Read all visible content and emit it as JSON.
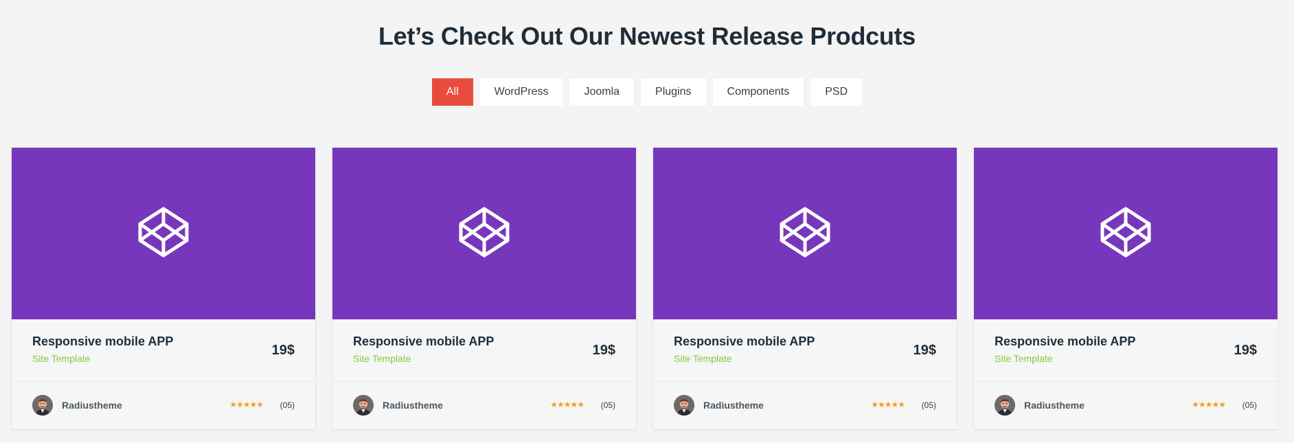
{
  "section": {
    "heading": "Let’s Check Out Our Newest Release Prodcuts"
  },
  "filters": {
    "items": [
      "All",
      "WordPress",
      "Joomla",
      "Plugins",
      "Components",
      "PSD"
    ],
    "active_index": 0
  },
  "colors": {
    "accent": "#e84c3d",
    "thumb_bg": "#7637bc",
    "subtitle_green": "#8cc63f",
    "star": "#f0a020"
  },
  "products": [
    {
      "title": "Responsive mobile APP",
      "category": "Site Template",
      "price": "19$",
      "author": "Radiustheme",
      "stars": "★★★★★",
      "rating_value": 5,
      "reviews": "(05)",
      "thumb_icon": "codepen-icon"
    },
    {
      "title": "Responsive mobile APP",
      "category": "Site Template",
      "price": "19$",
      "author": "Radiustheme",
      "stars": "★★★★★",
      "rating_value": 5,
      "reviews": "(05)",
      "thumb_icon": "codepen-icon"
    },
    {
      "title": "Responsive mobile APP",
      "category": "Site Template",
      "price": "19$",
      "author": "Radiustheme",
      "stars": "★★★★★",
      "rating_value": 5,
      "reviews": "(05)",
      "thumb_icon": "codepen-icon"
    },
    {
      "title": "Responsive mobile APP",
      "category": "Site Template",
      "price": "19$",
      "author": "Radiustheme",
      "stars": "★★★★★",
      "rating_value": 5,
      "reviews": "(05)",
      "thumb_icon": "codepen-icon"
    }
  ]
}
